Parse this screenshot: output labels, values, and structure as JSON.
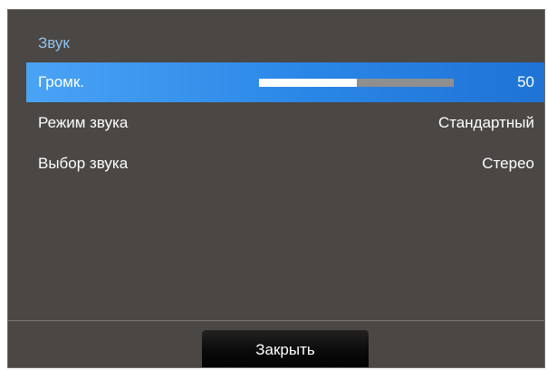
{
  "menu": {
    "title": "Звук",
    "items": [
      {
        "label": "Громк.",
        "value": "50",
        "level_percent": 50,
        "selected": true
      },
      {
        "label": "Режим звука",
        "value": "Стандартный",
        "selected": false
      },
      {
        "label": "Выбор звука",
        "value": "Стерео",
        "selected": false
      }
    ]
  },
  "footer": {
    "close_label": "Закрыть"
  },
  "colors": {
    "background": "#4b4744",
    "title": "#8ec3ef",
    "selection": "#2a86e6",
    "slider_track": "#8f8f8f",
    "slider_fill": "#ffffff"
  }
}
